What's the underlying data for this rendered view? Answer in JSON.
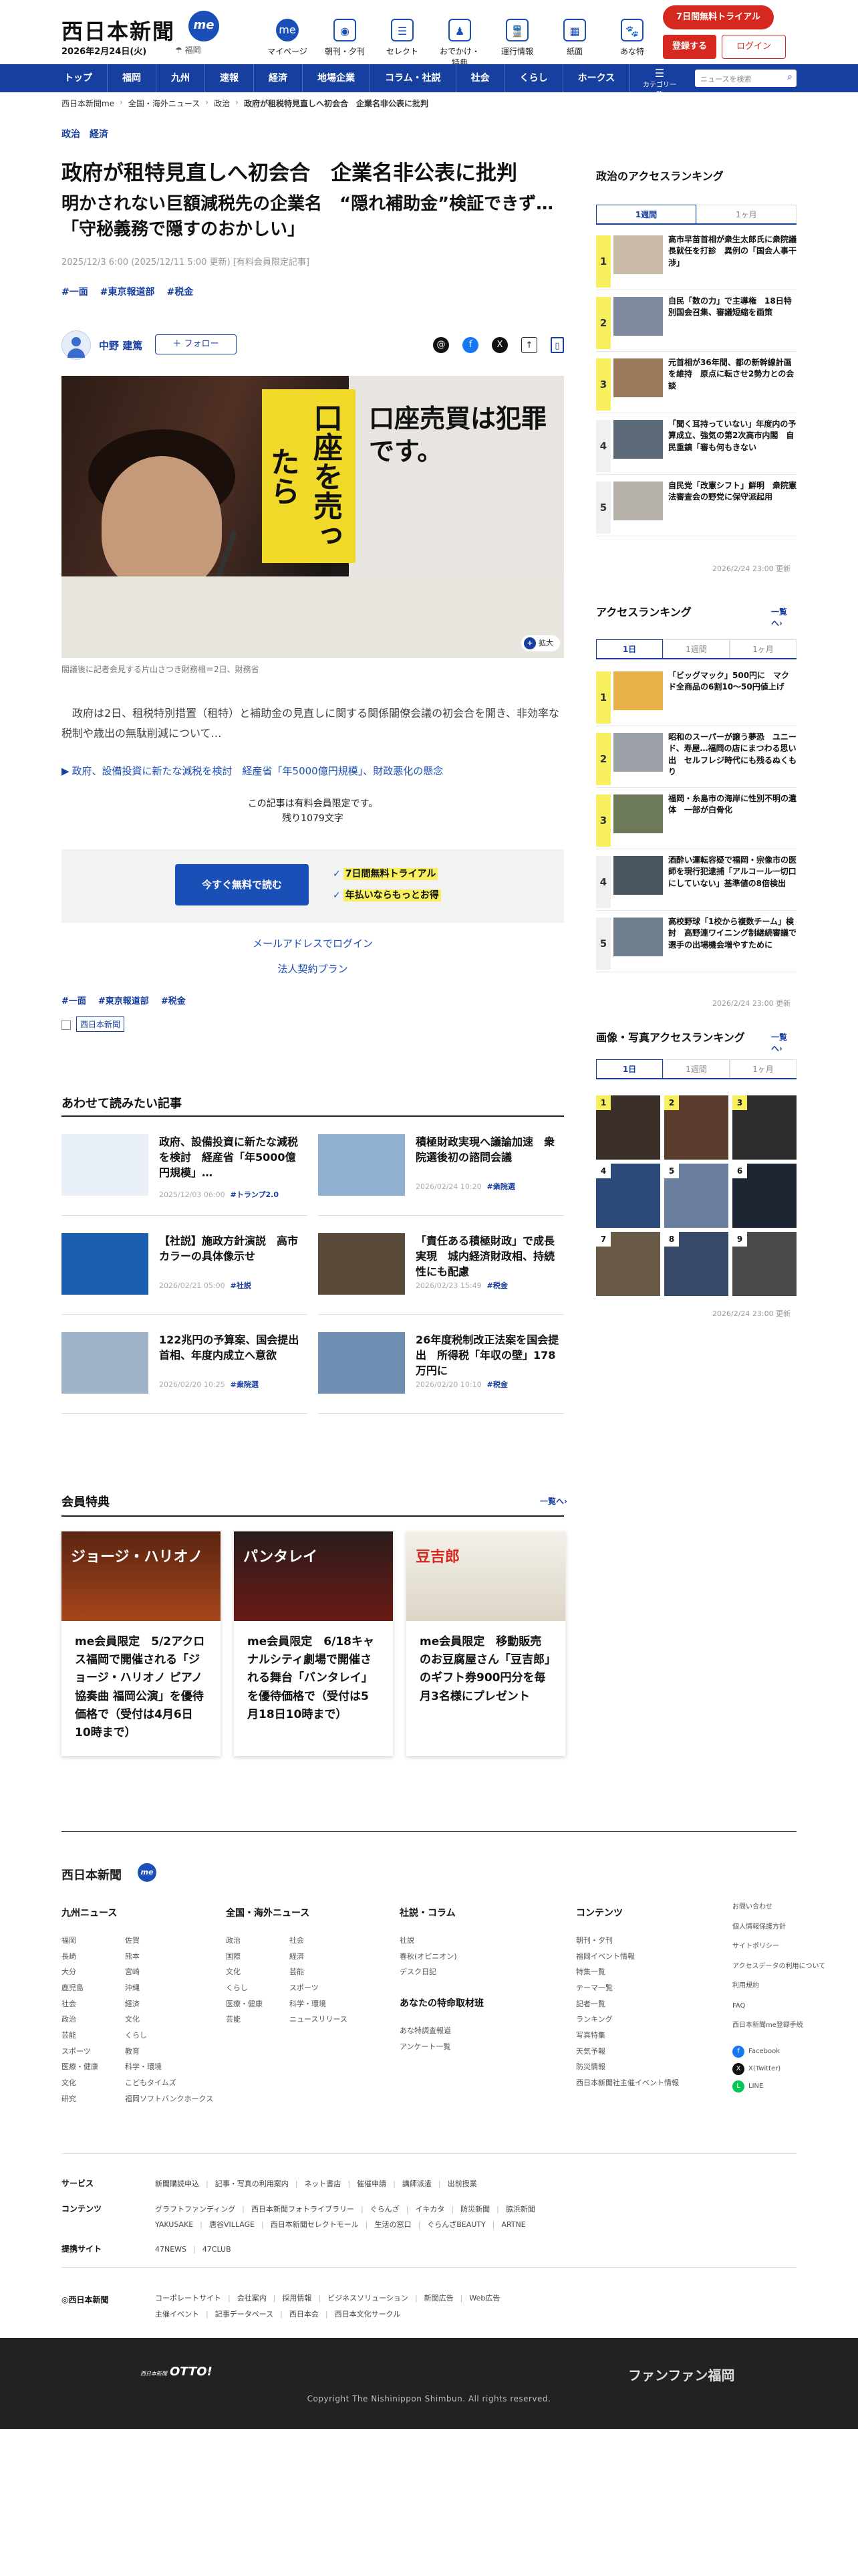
{
  "header": {
    "logo": "西日本新聞",
    "me": "me",
    "date": "2026年2月24日(火)",
    "weather": "☂ 福岡",
    "topnav": [
      {
        "label": "マイページ",
        "icon": "me"
      },
      {
        "label": "朝刊・夕刊",
        "icon": "◉"
      },
      {
        "label": "セレクト",
        "icon": "☰"
      },
      {
        "label": "おでかけ・特典",
        "icon": "♟"
      },
      {
        "label": "運行情報",
        "icon": "🚆"
      },
      {
        "label": "紙面",
        "icon": "▦"
      },
      {
        "label": "あな特",
        "icon": "🐾"
      }
    ],
    "trial": "7日間無料トライアル",
    "register": "登録する",
    "login": "ログイン"
  },
  "gnav": {
    "items": [
      "トップ",
      "福岡",
      "九州",
      "速報",
      "経済",
      "地場企業",
      "コラム・社説",
      "社会",
      "くらし",
      "ホークス"
    ],
    "category": "カテゴリ一覧",
    "search_placeholder": "ニュースを検索"
  },
  "breadcrumb": [
    "西日本新聞me",
    "全国・海外ニュース",
    "政治",
    "政府が租税特見直しへ初会合　企業名非公表に批判"
  ],
  "article": {
    "cats": [
      "政治",
      "経済"
    ],
    "title": "政府が租特見直しへ初会合　企業名非公表に批判",
    "subtitle": "明かされない巨額減税先の企業名　“隠れ補助金”検証できず…「守秘義務で隠すのおかしい」",
    "meta": "2025/12/3 6:00 (2025/12/11 5:00 更新) [有料会員限定記事]",
    "tags": [
      "#一面",
      "#東京報道部",
      "#税金"
    ],
    "author": "中野 建篤",
    "follow": "＋ フォロー",
    "zoom": "拡大",
    "board_text": "口座売買は犯罪です。",
    "yellow_text": "口座を売ったら",
    "caption": "閣議後に記者会見する片山さつき財務相＝2日、財務省",
    "lead": "政府は2日、租税特別措置（租特）と補助金の見直しに関する関係閣僚会議の初会合を開き、非効率な税制や歳出の無駄削減について…",
    "related": "政府、設備投資に新たな減税を検討　経産省「年5000億円規模」、財政悪化の懸念",
    "paywall1": "この記事は有料会員限定です。",
    "paywall2": "残り1079文字",
    "read_btn": "今すぐ無料で読む",
    "perk1": "7日間無料トライアル",
    "perk2": "年払いならもっとお得",
    "mail_login": "メールアドレスでログイン",
    "corp": "法人契約プラン",
    "source": "西日本新聞"
  },
  "related_section": {
    "title": "あわせて読みたい記事",
    "items": [
      {
        "title": "政府、設備投資に新たな減税を検討　経産省「年5000億円規模」…",
        "meta": "2025/12/03 06:00",
        "tag": "#トランプ2.0"
      },
      {
        "title": "積極財政実現へ議論加速　衆院選後初の諮問会議",
        "meta": "2026/02/24 10:20",
        "tag": "#衆院選"
      },
      {
        "title": "【社説】施政方針演説　高市カラーの具体像示せ",
        "meta": "2026/02/21 05:00",
        "tag": "#社説"
      },
      {
        "title": "「責任ある積極財政」で成長実現　城内経済財政相、持続性にも配慮",
        "meta": "2026/02/23 15:49",
        "tag": "#税金"
      },
      {
        "title": "122兆円の予算案、国会提出　首相、年度内成立へ意欲",
        "meta": "2026/02/20 10:25",
        "tag": "#衆院選"
      },
      {
        "title": "26年度税制改正法案を国会提出　所得税「年収の壁」178万円に",
        "meta": "2026/02/20 10:10",
        "tag": "#税金"
      }
    ]
  },
  "member_section": {
    "title": "会員特典",
    "more": "一覧へ",
    "cards": [
      {
        "title": "me会員限定　5/2アクロス福岡で開催される「ジョージ・ハリオノ ピアノ協奏曲 福岡公演」を優待価格で（受付は4月6日10時まで）",
        "img_text": "ジョージ・ハリオノ"
      },
      {
        "title": "me会員限定　6/18キャナルシティ劇場で開催される舞台「バンタレイ」を優待価格で（受付は5月18日10時まで）",
        "img_text": "パンタレイ"
      },
      {
        "title": "me会員限定　移動販売のお豆腐屋さん「豆吉郎」のギフト券900円分を毎月3名様にプレゼント",
        "img_text": "豆吉郎"
      }
    ]
  },
  "sidebar": {
    "politics_rank": {
      "title": "政治のアクセスランキング",
      "tabs": [
        "1週間",
        "1ヶ月"
      ],
      "items": [
        "高市早苗首相が衆生太郎氏に衆院議長就任を打診　異例の「国会人事干渉」",
        "自民「数の力」で主導権　18日特別国会召集、審議短縮を画策",
        "元首相が36年間、都の新幹線計画を維持　原点に転させ2勢力との会談",
        "「聞く耳持っていない」年度内の予算成立、強気の第2次高市内閣　自民重鎮「審も何もきない",
        "自民党「改憲シフト」鮮明　衆院憲法審査会の野党に保守派起用"
      ],
      "updated": "2026/2/24 23:00 更新"
    },
    "access_rank": {
      "title": "アクセスランキング",
      "more": "一覧へ",
      "tabs": [
        "1日",
        "1週間",
        "1ヶ月"
      ],
      "items": [
        "「ビッグマック」500円に　マクド全商品の6割10～50円値上げ",
        "昭和のスーパーが譲う夢恐　ユニード、寿屋…福岡の店にまつわる思い出　セルフレジ時代にも残るぬくもり",
        "福岡・糸島市の海岸に性別不明の遺体　一部が白骨化",
        "酒酔い運転容疑で福岡・宗像市の医師を現行犯逮捕「アルコール一切口にしていない」基準値の8倍検出",
        "高校野球「1校から複数チーム」検討　高野連ワイニング制継続審議で　選手の出場機会増やすために"
      ],
      "updated": "2026/2/24 23:00 更新"
    },
    "photo_rank": {
      "title": "画像・写真アクセスランキング",
      "more": "一覧へ",
      "tabs": [
        "1日",
        "1週間",
        "1ヶ月"
      ],
      "nums": [
        "1",
        "2",
        "3",
        "4",
        "5",
        "6",
        "7",
        "8",
        "9"
      ],
      "updated": "2026/2/24 23:00 更新"
    }
  },
  "footer": {
    "logo": "西日本新聞",
    "cols": [
      {
        "title": "九州ニュース",
        "a": [
          "福岡",
          "長崎",
          "大分",
          "鹿児島",
          "社会",
          "政治",
          "芸能",
          "スポーツ",
          "医療・健康",
          "文化",
          "研究"
        ],
        "b": [
          "佐賀",
          "熊本",
          "宮崎",
          "沖縄",
          "経済",
          "文化",
          "くらし",
          "教育",
          "科学・環境",
          "こどもタイムズ",
          "福岡ソフトバンクホークス"
        ]
      },
      {
        "title": "全国・海外ニュース",
        "a": [
          "政治",
          "国際",
          "文化",
          "くらし",
          "医療・健康",
          "芸能"
        ],
        "b": [
          "社会",
          "経済",
          "芸能",
          "スポーツ",
          "科学・環境",
          "ニュースリリース"
        ]
      },
      {
        "title": "社説・コラム",
        "a": [
          "社説",
          "春秋(オピニオン)",
          "デスク日記"
        ],
        "sub": "あなたの特命取材班",
        "c": [
          "あな特調査報道",
          "アンケート一覧"
        ]
      },
      {
        "title": "コンテンツ",
        "a": [
          "朝刊・夕刊",
          "福岡イベント情報",
          "特集一覧",
          "テーマ一覧",
          "記者一覧",
          "ランキング",
          "写真特集",
          "天気予報",
          "防災情報",
          "西日本新聞社主催イベント情報"
        ]
      }
    ],
    "links": [
      "お問い合わせ",
      "個人情報保護方針",
      "サイトポリシー",
      "アクセスデータの利用について",
      "利用規約",
      "FAQ",
      "西日本新聞me登録手続"
    ],
    "social": [
      {
        "name": "Facebook",
        "icon": "f"
      },
      {
        "name": "X(Twitter)",
        "icon": "X"
      },
      {
        "name": "LINE",
        "icon": "L"
      }
    ],
    "service_label": "サービス",
    "service": [
      "新聞購読申込",
      "記事・写真の利用案内",
      "ネット書店",
      "催催申請",
      "講師派遣",
      "出前授業"
    ],
    "content_label": "コンテンツ",
    "content": [
      "グラフトファンディング",
      "西日本新聞フォトライブラリー",
      "ぐらんざ",
      "イキカタ",
      "防災新聞",
      "脇浜新聞"
    ],
    "content2": [
      "YAKUSAKE",
      "唐谷VILLAGE",
      "西日本新聞セレクトモール",
      "生活の窓口",
      "ぐらんざBEAUTY",
      "ARTNE"
    ],
    "partner_label": "提携サイト",
    "partner": [
      "47NEWS",
      "47CLUB"
    ],
    "corp_logo": "◎西日本新聞",
    "corp": [
      "コーポレートサイト",
      "会社案内",
      "採用情報",
      "ビジネスソリューション",
      "新聞広告",
      "Web広告"
    ],
    "corp2": [
      "主催イベント",
      "記事データベース",
      "西日本会",
      "西日本文化サークル"
    ],
    "otto_small": "西日本新聞",
    "otto": "OTTO!",
    "fanfan": "ファンファン福岡",
    "copyright": "Copyright The Nishinippon Shimbun. All rights reserved."
  },
  "colors": {
    "brand": "#173fa0",
    "accent": "#d5281f",
    "highlight": "#f7ef5d"
  }
}
